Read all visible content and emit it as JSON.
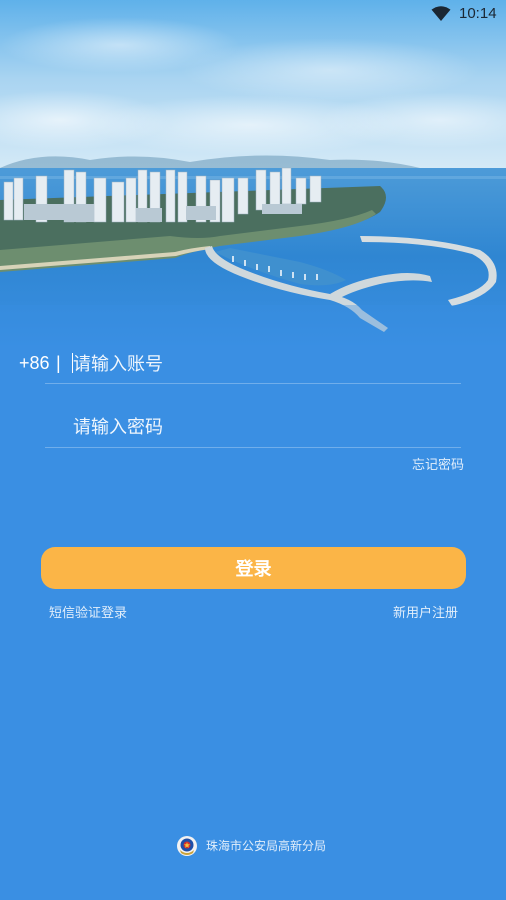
{
  "status_bar": {
    "time": "10:14",
    "wifi_icon": "wifi-icon"
  },
  "hero": {
    "image": "zhuhai-coastline-photo"
  },
  "login_form": {
    "country_code": "+86",
    "separator": "|",
    "account_placeholder": "请输入账号",
    "password_placeholder": "请输入密码",
    "forgot_password": "忘记密码",
    "login_button": "登录",
    "sms_login": "短信验证登录",
    "register": "新用户注册"
  },
  "footer": {
    "emblem_icon": "police-emblem-icon",
    "organization": "珠海市公安局高新分局"
  },
  "colors": {
    "background": "#3a8fe3",
    "login_button": "#fbb547",
    "text": "#ffffff"
  }
}
